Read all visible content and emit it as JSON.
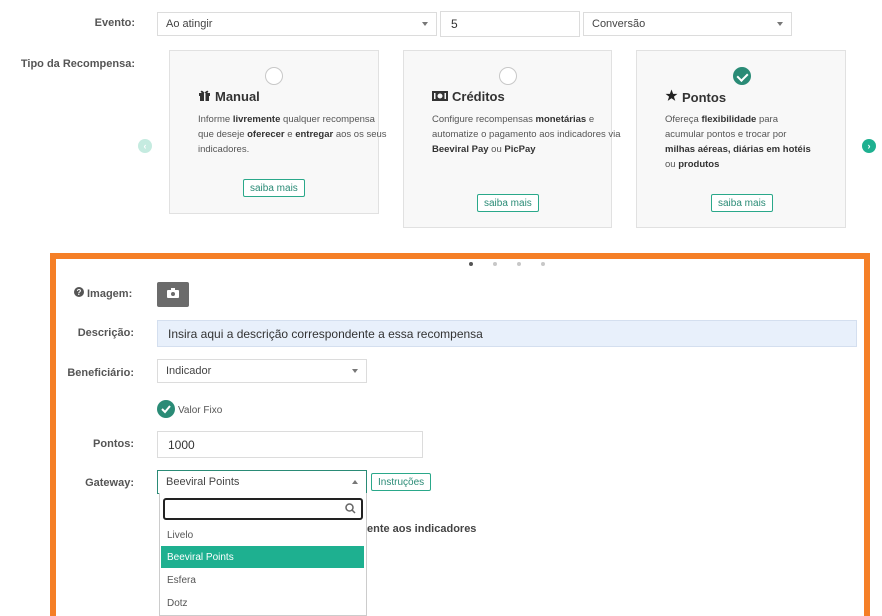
{
  "evento": {
    "label": "Evento:",
    "trigger_value": "Ao atingir",
    "quantity_value": "5",
    "type_value": "Conversão"
  },
  "tipo_recompensa": {
    "label": "Tipo da Recompensa:",
    "cards": [
      {
        "title": "Manual",
        "icon": "gift-icon",
        "desc_parts": [
          "Informe ",
          "livremente",
          " qualquer recompensa que deseje ",
          "oferecer",
          " e ",
          "entregar",
          " aos os seus indicadores."
        ],
        "button": "saiba mais",
        "selected": false
      },
      {
        "title": "Créditos",
        "icon": "money-icon",
        "desc_parts": [
          "Configure recompensas ",
          "monetárias",
          " e automatize o pagamento aos indicadores via ",
          "Beeviral Pay",
          " ou ",
          "PicPay"
        ],
        "button": "saiba mais",
        "selected": false
      },
      {
        "title": "Pontos",
        "icon": "star-icon",
        "desc_parts": [
          "Ofereça ",
          "flexibilidade",
          " para acumular pontos e trocar por ",
          "milhas aéreas, diárias em hotéis",
          " ou ",
          "produtos"
        ],
        "button": "saiba mais",
        "selected": true
      }
    ]
  },
  "form": {
    "imagem_label": "Imagem:",
    "descricao_label": "Descrição:",
    "descricao_placeholder": "Insira aqui a descrição correspondente a essa recompensa",
    "beneficiario_label": "Beneficiário:",
    "beneficiario_value": "Indicador",
    "valor_fixo_label": "Valor Fixo",
    "pontos_label": "Pontos:",
    "pontos_value": "1000",
    "gateway_label": "Gateway:",
    "gateway_value": "Beeviral Points",
    "instrucoes_button": "Instruções",
    "partial_text": "ente aos indicadores"
  },
  "gateway_dropdown": {
    "search_value": "",
    "options": [
      "Livelo",
      "Beeviral Points",
      "Esfera",
      "Dotz"
    ],
    "selected": "Beeviral Points"
  },
  "colors": {
    "accent": "#2a8b76",
    "highlight": "#1eb090",
    "frame": "#f57f27",
    "nav_left": "#c5ebe0",
    "nav_right": "#1eb090"
  }
}
